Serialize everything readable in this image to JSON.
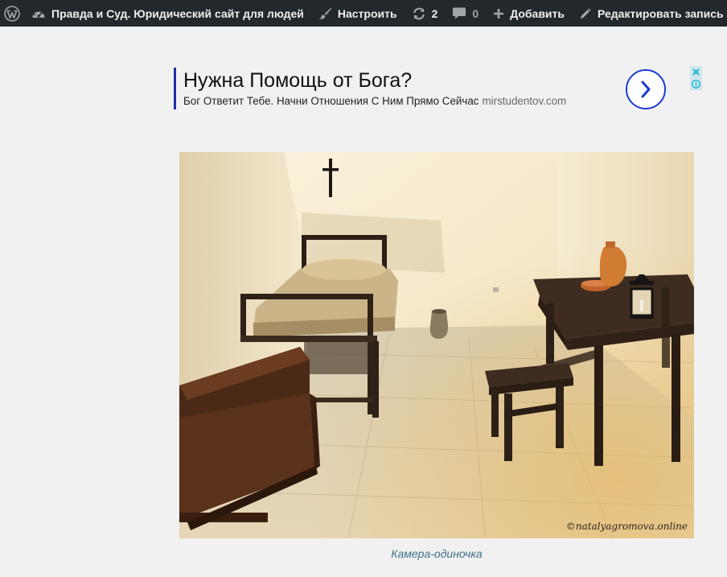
{
  "adminbar": {
    "wp_logo_icon": "wordpress-icon",
    "site_name": "Правда и Суд. Юридический сайт для людей",
    "customize": "Настроить",
    "updates_count": "2",
    "comments_count": "0",
    "new_content": "Добавить",
    "edit_post": "Редактировать запись"
  },
  "ad": {
    "title": "Нужна Помощь от Бога?",
    "description": "Бог Ответит Тебе. Начни Отношения С Ним Прямо Сейчас",
    "domain": "mirstudentov.com",
    "accent_color": "#1a3bd1"
  },
  "figure": {
    "watermark": "©natalyagromova.online",
    "caption": "Камера-одиночка"
  },
  "colors": {
    "adminbar_bg": "#23282d",
    "page_bg": "#f1f1f1",
    "caption": "#3d6f86"
  }
}
